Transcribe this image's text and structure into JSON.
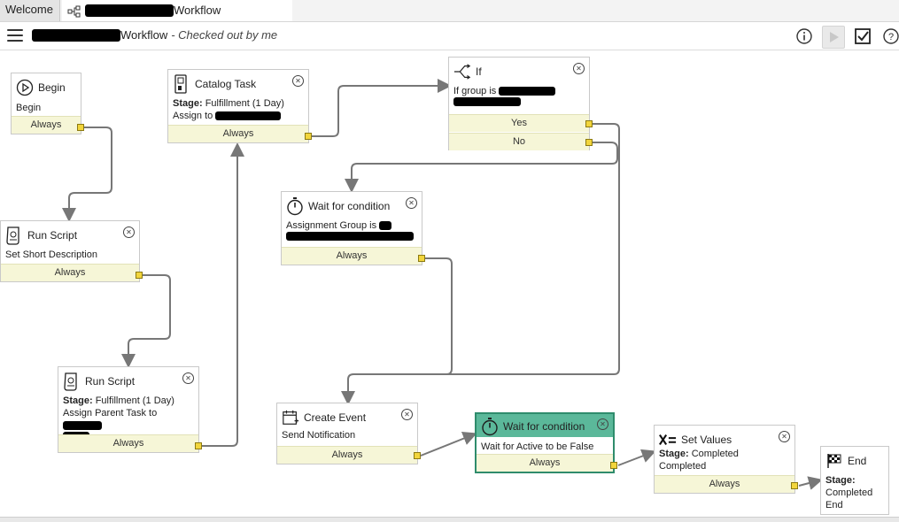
{
  "tabs": {
    "welcome": "Welcome",
    "workflow": "Workflow"
  },
  "header": {
    "title": "Workflow",
    "status": "- Checked out by me"
  },
  "nodes": {
    "begin": {
      "title": "Begin",
      "body": "Begin",
      "footer": "Always"
    },
    "catalog_task": {
      "title": "Catalog Task",
      "stage_label": "Stage:",
      "stage_value": "Fulfillment (1 Day)",
      "assign": "Assign to",
      "footer": "Always"
    },
    "if": {
      "title": "If",
      "body": "If group is",
      "yes": "Yes",
      "no": "No"
    },
    "wait1": {
      "title": "Wait for condition",
      "body": "Assignment Group is",
      "footer": "Always"
    },
    "run_script1": {
      "title": "Run Script",
      "body": "Set Short Description",
      "footer": "Always"
    },
    "run_script2": {
      "title": "Run Script",
      "stage_label": "Stage:",
      "stage_value": "Fulfillment (1 Day)",
      "assign": "Assign Parent Task to",
      "footer": "Always"
    },
    "create_event": {
      "title": "Create Event",
      "body": "Send Notification",
      "footer": "Always"
    },
    "wait2": {
      "title": "Wait for condition",
      "body": "Wait for Active to be False",
      "footer": "Always"
    },
    "set_values": {
      "title": "Set Values",
      "stage_label": "Stage:",
      "stage_value": "Completed",
      "body2": "Completed",
      "footer": "Always"
    },
    "end": {
      "title": "End",
      "stage_label": "Stage:",
      "stage_value": "Completed",
      "body2": "End"
    }
  },
  "colors": {
    "active_node": "#5bb89a",
    "footer": "#f6f6d7",
    "port": "#f2d53c",
    "connector": "#777777"
  }
}
